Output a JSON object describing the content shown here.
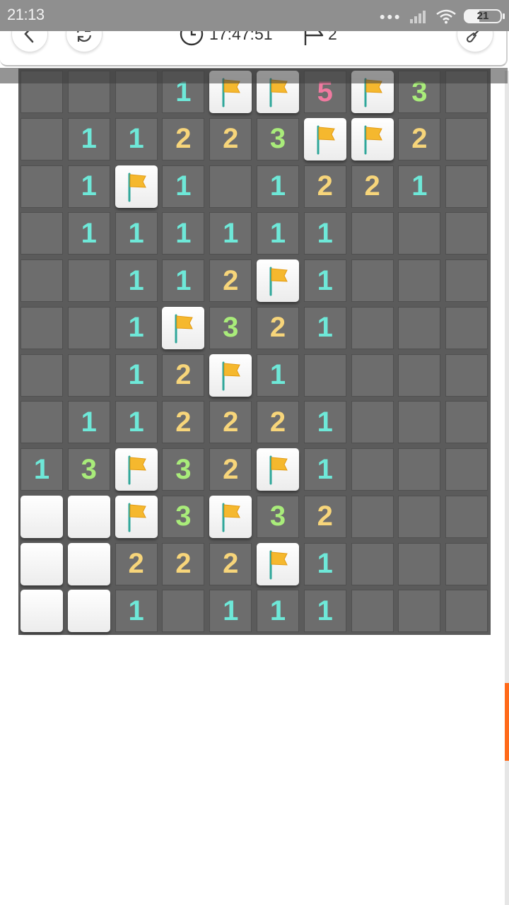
{
  "status": {
    "time": "21:13",
    "battery": "21"
  },
  "toolbar": {
    "back_icon": "chevron-left-icon",
    "restart_icon": "refresh-icon",
    "timer": "17:47:51",
    "flags_count": "2",
    "tool_icon": "shovel-icon"
  },
  "colors": {
    "n1": "#6ee8d8",
    "n2": "#f7d57a",
    "n3": "#a9ec7a",
    "n5": "#f07aa0",
    "flag": "#f5b82e",
    "scroll": "#ff6a1a"
  },
  "board": {
    "rows": [
      [
        "H",
        "H",
        "H",
        "1",
        "F",
        "F",
        "5",
        "F",
        "3",
        "H"
      ],
      [
        "H",
        "1",
        "1",
        "2",
        "2",
        "3",
        "F",
        "F",
        "2",
        "H"
      ],
      [
        "H",
        "1",
        "F",
        "1",
        "E",
        "1",
        "2",
        "2",
        "1",
        "H"
      ],
      [
        "H",
        "1",
        "1",
        "1",
        "1",
        "1",
        "1",
        "H",
        "H",
        "H"
      ],
      [
        "H",
        "H",
        "1",
        "1",
        "2",
        "F",
        "1",
        "H",
        "H",
        "H"
      ],
      [
        "H",
        "H",
        "1",
        "F",
        "3",
        "2",
        "1",
        "H",
        "H",
        "H"
      ],
      [
        "H",
        "H",
        "1",
        "2",
        "F",
        "1",
        "E",
        "H",
        "H",
        "H"
      ],
      [
        "H",
        "1",
        "1",
        "2",
        "2",
        "2",
        "1",
        "H",
        "H",
        "H"
      ],
      [
        "1",
        "3",
        "F",
        "3",
        "2",
        "F",
        "1",
        "H",
        "H",
        "H"
      ],
      [
        "B",
        "B",
        "F",
        "3",
        "F",
        "3",
        "2",
        "H",
        "H",
        "H"
      ],
      [
        "B",
        "B",
        "2",
        "2",
        "2",
        "F",
        "1",
        "H",
        "H",
        "H"
      ],
      [
        "B",
        "B",
        "1",
        "E",
        "1",
        "1",
        "1",
        "H",
        "H",
        "H"
      ]
    ]
  }
}
